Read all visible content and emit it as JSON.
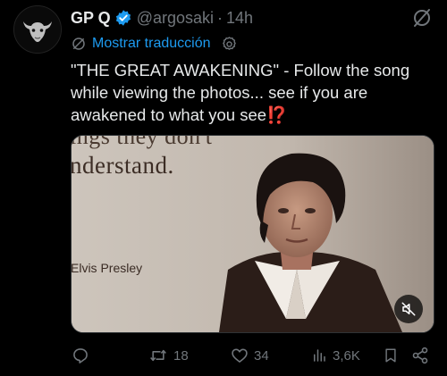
{
  "colors": {
    "background": "#000000",
    "text": "#e7e9ea",
    "muted": "#71767b",
    "accent": "#1d9bf0",
    "verified": "#1d9bf0",
    "emoji": "#f4212e"
  },
  "tweet": {
    "author_name": "GP Q",
    "handle": "@argosaki",
    "separator": "·",
    "time": "14h",
    "text": "\"THE GREAT AWAKENING\" - Follow the song while viewing the photos... see if you are awakened to what you see",
    "emoji": "⁉️",
    "translate_label": "Mostrar traducción",
    "icons": {
      "avatar": "bull-skull-avatar",
      "verified": "verified-badge-icon",
      "grok": "grok-icon",
      "translate": "translate-icon",
      "settings": "gear-icon",
      "mute": "muted-speaker-icon"
    }
  },
  "media": {
    "caption_line1": "ings they don't",
    "caption_line2": "nderstand.",
    "caption_name": "Elvis Presley"
  },
  "actions": {
    "reply_count": "",
    "retweet_count": "18",
    "like_count": "34",
    "views_count": "3,6K",
    "bookmark_count": "",
    "share_count": ""
  }
}
